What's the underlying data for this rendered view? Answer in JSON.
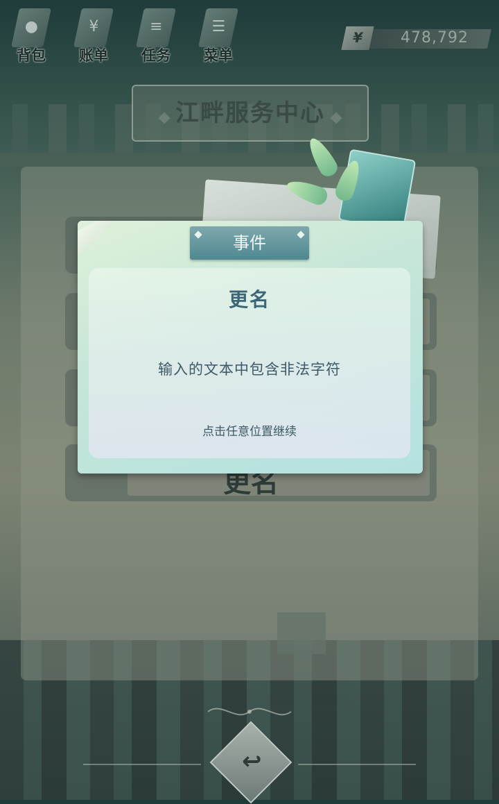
{
  "top_menu": {
    "items": [
      {
        "label": "背包",
        "icon": "bag-icon"
      },
      {
        "label": "账单",
        "icon": "bill-icon"
      },
      {
        "label": "任务",
        "icon": "task-icon"
      },
      {
        "label": "菜单",
        "icon": "menu-icon"
      }
    ],
    "money": {
      "symbol": "¥",
      "value": "478,792"
    }
  },
  "page": {
    "title": "江畔服务中心"
  },
  "background_menu": {
    "visible_item": "更名"
  },
  "dialog": {
    "header": "事件",
    "title": "更名",
    "message": "输入的文本中包含非法字符",
    "hint": "点击任意位置继续"
  },
  "colors": {
    "dialog_header": "#4f8891",
    "dialog_title": "#3c6676",
    "accent_teal": "#2f7a78"
  }
}
